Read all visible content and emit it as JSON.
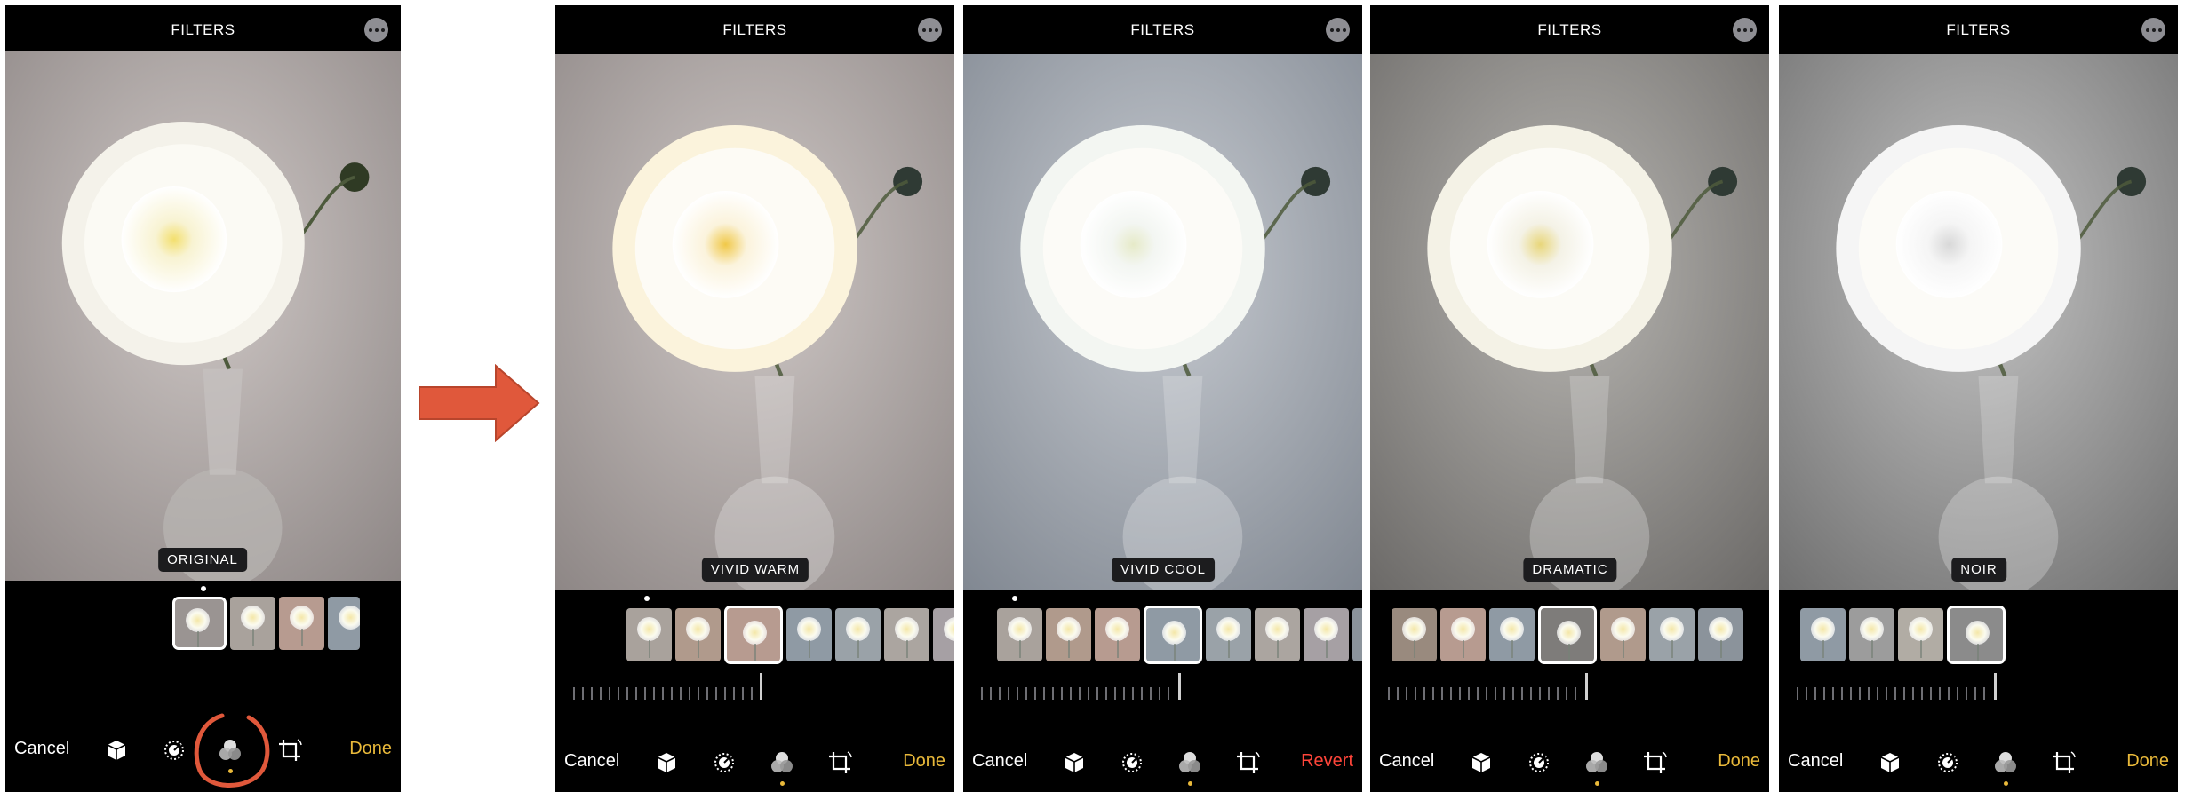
{
  "colors": {
    "done": "#e9b93a",
    "revert": "#ff453a",
    "arrow": "#e0583b",
    "annotation_circle": "#e0583b"
  },
  "screens": [
    {
      "title": "FILTERS",
      "filter_label": "ORIGINAL",
      "left_button": "Cancel",
      "right_button": "Done",
      "tint": "neutral"
    },
    {
      "title": "FILTERS",
      "filter_label": "VIVID WARM",
      "left_button": "Cancel",
      "right_button": "Done",
      "tint": "warm"
    },
    {
      "title": "FILTERS",
      "filter_label": "VIVID COOL",
      "left_button": "Cancel",
      "right_button": "Revert",
      "tint": "cool"
    },
    {
      "title": "FILTERS",
      "filter_label": "DRAMATIC",
      "left_button": "Cancel",
      "right_button": "Done",
      "tint": "dramatic"
    },
    {
      "title": "FILTERS",
      "filter_label": "NOIR",
      "left_button": "Cancel",
      "right_button": "Done",
      "tint": "noir"
    }
  ],
  "icons": {
    "more": "ellipsis-circle-icon",
    "live": "cube-icon",
    "adjust": "adjust-dial-icon",
    "filters": "filters-circles-icon",
    "crop": "crop-rotate-icon"
  }
}
